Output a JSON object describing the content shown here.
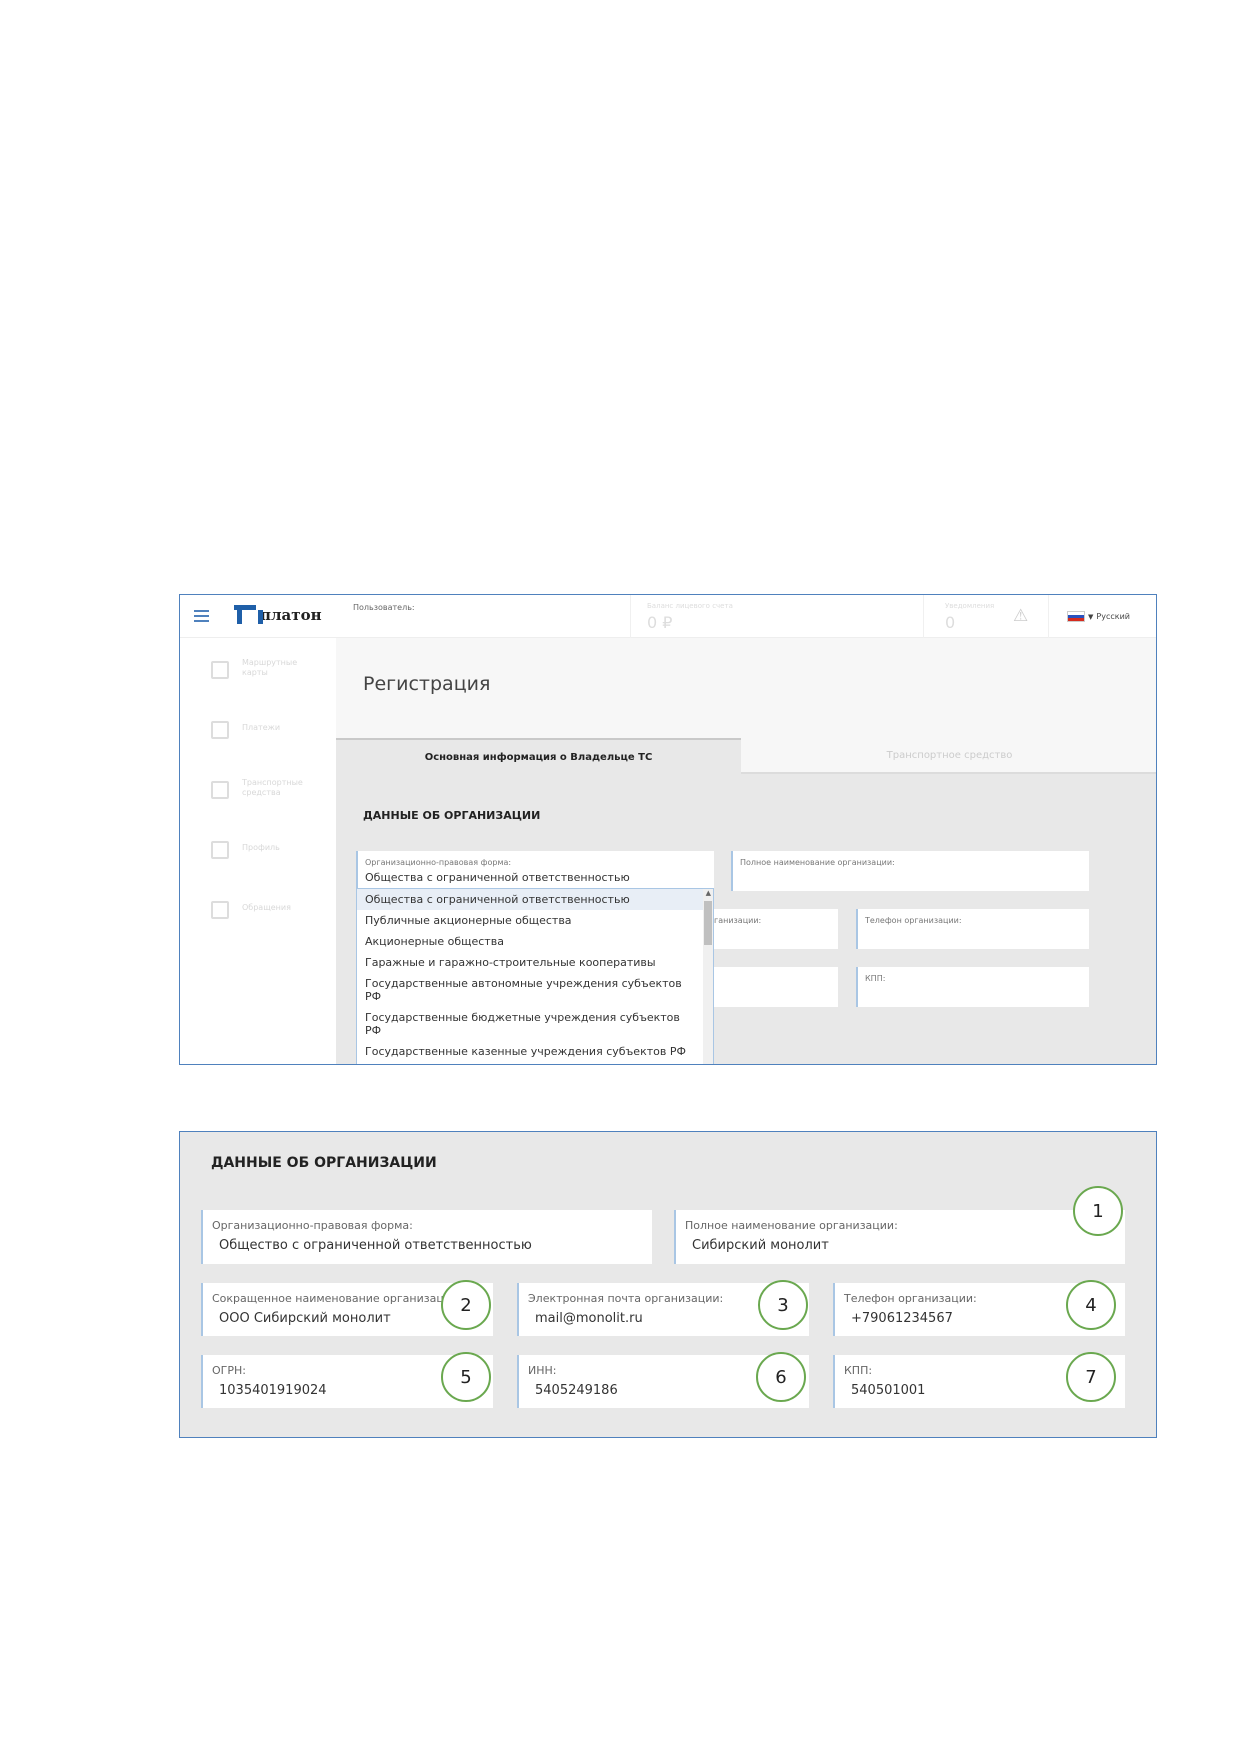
{
  "screen1": {
    "brand": "платон",
    "user_label": "Пользователь:",
    "balance_label": "Баланс лицевого счета",
    "balance_value": "0 ₽",
    "notifications_label": "Уведомления",
    "notifications_value": "0",
    "language": "Русский",
    "sidebar": [
      {
        "label": "Маршрутные карты"
      },
      {
        "label": "Платежи"
      },
      {
        "label": "Транспортные средства"
      },
      {
        "label": "Профиль"
      },
      {
        "label": "Обращения"
      }
    ],
    "page_title": "Регистрация",
    "tabs": [
      {
        "label": "Основная информация о Владельце ТС"
      },
      {
        "label": "Транспортное средство"
      }
    ],
    "section_title": "ДАННЫЕ ОБ ОРГАНИЗАЦИИ",
    "fields": {
      "legal_form_label": "Организационно-правовая форма:",
      "legal_form_value": "Общества с ограниченной ответственностью",
      "full_name_label": "Полное наименование организации:",
      "email_label_fragment": "ганизации:",
      "phone_label": "Телефон организации:",
      "kpp_label": "КПП:"
    },
    "dropdown_options": [
      "Общества с ограниченной ответственностью",
      "Публичные акционерные общества",
      "Акционерные общества",
      "Гаражные и гаражно-строительные кооперативы",
      "Государственные автономные учреждения субъектов РФ",
      "Государственные бюджетные учреждения субъектов РФ",
      "Государственные казенные учреждения субъектов РФ"
    ],
    "flag_colors": [
      "#ffffff",
      "#2a52be",
      "#d52b1e"
    ],
    "accent_color": "#4f81bd"
  },
  "screen2": {
    "section_title": "ДАННЫЕ ОБ ОРГАНИЗАЦИИ",
    "fields": [
      {
        "label": "Организационно-правовая форма:",
        "value": "Общество с ограниченной  ответственностью"
      },
      {
        "label": "Полное наименование организации:",
        "value": "Сибирский  монолит",
        "badge": "1"
      },
      {
        "label": "Сокращенное наименование организации:",
        "value": "ООО Сибирский  монолит",
        "badge": "2"
      },
      {
        "label": "Электронная почта организации:",
        "value": "mail@monolit.ru",
        "badge": "3"
      },
      {
        "label": "Телефон организации:",
        "value": "+79061234567",
        "badge": "4"
      },
      {
        "label": "ОГРН:",
        "value": "1035401919024",
        "badge": "5"
      },
      {
        "label": "ИНН:",
        "value": "5405249186",
        "badge": "6"
      },
      {
        "label": "КПП:",
        "value": "540501001",
        "badge": "7"
      }
    ],
    "badge_color": "#6aa84f"
  }
}
